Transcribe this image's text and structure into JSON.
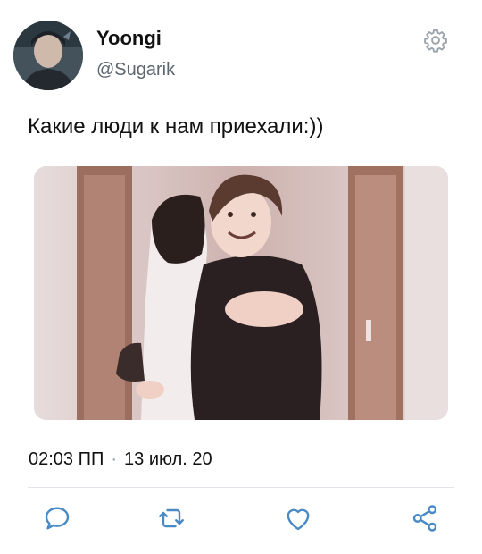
{
  "user": {
    "display_name": "Yoongi",
    "handle": "@Sugarik",
    "avatar_icon": "profile-photo"
  },
  "header": {
    "settings_icon": "gear-icon"
  },
  "tweet": {
    "text": "Какие люди к нам приехали:))",
    "media": "photo-two-people-hugging",
    "time": "02:03 ПП",
    "separator": "·",
    "date": "13 июл. 20"
  },
  "actions": [
    {
      "name": "reply",
      "icon": "comment-icon"
    },
    {
      "name": "retweet",
      "icon": "retweet-icon"
    },
    {
      "name": "like",
      "icon": "heart-icon"
    },
    {
      "name": "share",
      "icon": "share-icon"
    }
  ],
  "colors": {
    "text": "#111111",
    "secondary": "#5b6670",
    "icon": "#4a8ac4",
    "gear": "#9aa3ab",
    "divider": "#e1e4e8"
  }
}
